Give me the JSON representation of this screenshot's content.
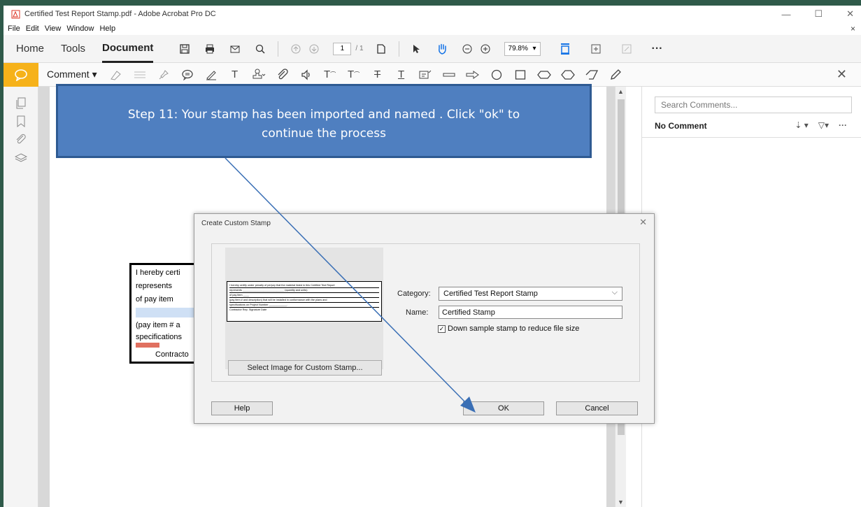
{
  "window": {
    "title": "Certified Test Report Stamp.pdf - Adobe Acrobat Pro DC",
    "controls": {
      "minimize": "—",
      "maximize": "☐",
      "close": "✕"
    }
  },
  "menubar": {
    "items": [
      "File",
      "Edit",
      "View",
      "Window",
      "Help"
    ],
    "close_doc": "×"
  },
  "toolbar": {
    "tabs": [
      "Home",
      "Tools",
      "Document"
    ],
    "page_current": "1",
    "page_total": "/ 1",
    "zoom": "79.8%",
    "more": "···"
  },
  "comment_toolbar": {
    "label": "Comment ▾",
    "close": "✕"
  },
  "callout": {
    "text_line1": "Step 11: Your stamp has been imported and named . Click \"ok\" to",
    "text_line2": "continue the process"
  },
  "page_stamp": {
    "lines": [
      "I hereby certi",
      "represents ",
      "of pay item ",
      "(pay item # a",
      "specifications",
      "Contracto"
    ]
  },
  "right_panel": {
    "search_placeholder": "Search Comments...",
    "no_comment": "No Comment",
    "sort_icon": "⇣ ▾",
    "filter_icon": "▽▾",
    "more": "···"
  },
  "dialog": {
    "title": "Create Custom Stamp",
    "close": "✕",
    "preview_lines": [
      "I hereby certify under penalty of perjury that the material listed in this Certified Test Report",
      "represents ____________________________ (quantity and units)",
      "of pay item ____",
      "(pay item # and description) that will be installed in conformance with the plans and",
      "specifications on Project Number ____________.",
      "Contractor Rep. Signature                 Date"
    ],
    "select_image_button": "Select Image for Custom Stamp...",
    "category_label": "Category:",
    "category_value": "Certified Test Report Stamp",
    "name_label": "Name:",
    "name_value": "Certified Stamp",
    "downsample_label": "Down sample stamp to reduce file size",
    "downsample_checked": true,
    "help_button": "Help",
    "ok_button": "OK",
    "cancel_button": "Cancel"
  },
  "colors": {
    "callout_fill": "#4f7fc0",
    "callout_border": "#2e5a92",
    "comment_accent": "#f6b21a",
    "arrow": "#3a6fb5"
  }
}
